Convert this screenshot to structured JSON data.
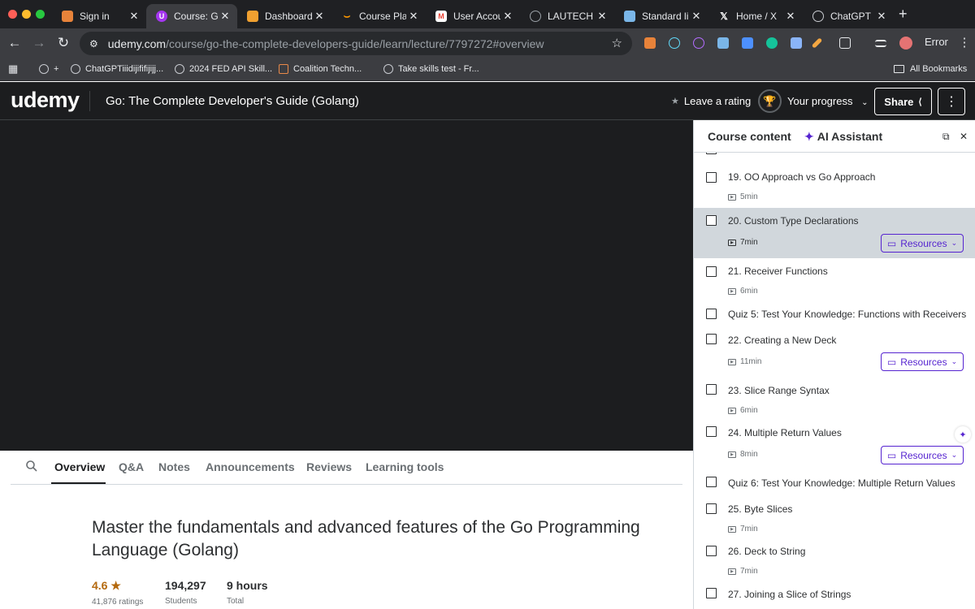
{
  "browser": {
    "tabs": [
      {
        "label": "Sign in",
        "icon": "shield-icon",
        "color": "#e8833a"
      },
      {
        "label": "Course: Go",
        "icon": "udemy-icon",
        "color": "#a435f0",
        "active": true
      },
      {
        "label": "Dashboard",
        "icon": "dashboard-icon",
        "color": "#f0a030"
      },
      {
        "label": "Course Play",
        "icon": "amazon-icon",
        "color": "#ff9900"
      },
      {
        "label": "User Accou",
        "icon": "gmail-icon",
        "color": "#ea4335"
      },
      {
        "label": "LAUTECH P",
        "icon": "globe-icon",
        "color": "#9aa0a6"
      },
      {
        "label": "Standard lib",
        "icon": "doc-icon",
        "color": "#7ab6e8"
      },
      {
        "label": "Home / X",
        "icon": "x-icon",
        "color": "#ffffff"
      },
      {
        "label": "ChatGPT",
        "icon": "chatgpt-icon",
        "color": "#9aa0a6"
      }
    ],
    "url_host": "udemy.com",
    "url_path": "/course/go-the-complete-developers-guide/learn/lecture/7797272#overview",
    "error_label": "Error",
    "bookmarks": [
      {
        "label": "+"
      },
      {
        "label": "ChatGPTiiidijififijijj..."
      },
      {
        "label": "2024 FED API Skill..."
      },
      {
        "label": "Coalition Techn..."
      },
      {
        "label": "Take skills test - Fr..."
      }
    ],
    "all_bookmarks": "All Bookmarks"
  },
  "header": {
    "logo": "udemy",
    "course_title": "Go: The Complete Developer's Guide (Golang)",
    "leave_rating": "Leave a rating",
    "your_progress": "Your progress",
    "share": "Share"
  },
  "content_tabs": [
    "Overview",
    "Q&A",
    "Notes",
    "Announcements",
    "Reviews",
    "Learning tools"
  ],
  "overview": {
    "headline": "Master the fundamentals and advanced features of the Go Programming Language (Golang)",
    "rating": "4.6",
    "ratings_count": "41,876 ratings",
    "students": "194,297",
    "students_label": "Students",
    "hours": "9 hours",
    "hours_label": "Total"
  },
  "sidebar": {
    "title": "Course content",
    "ai_tab": "AI Assistant",
    "resources_label": "Resources",
    "lectures": [
      {
        "title": "19. OO Approach vs Go Approach",
        "duration": "5min"
      },
      {
        "title": "20. Custom Type Declarations",
        "duration": "7min",
        "resources": true,
        "current": true
      },
      {
        "title": "21. Receiver Functions",
        "duration": "6min"
      },
      {
        "title": "Quiz 5: Test Your Knowledge: Functions with Receivers"
      },
      {
        "title": "22. Creating a New Deck",
        "duration": "11min",
        "resources": true
      },
      {
        "title": "23. Slice Range Syntax",
        "duration": "6min"
      },
      {
        "title": "24. Multiple Return Values",
        "duration": "8min",
        "resources": true
      },
      {
        "title": "Quiz 6: Test Your Knowledge: Multiple Return Values"
      },
      {
        "title": "25. Byte Slices",
        "duration": "7min"
      },
      {
        "title": "26. Deck to String",
        "duration": "7min"
      },
      {
        "title": "27. Joining a Slice of Strings"
      }
    ]
  }
}
